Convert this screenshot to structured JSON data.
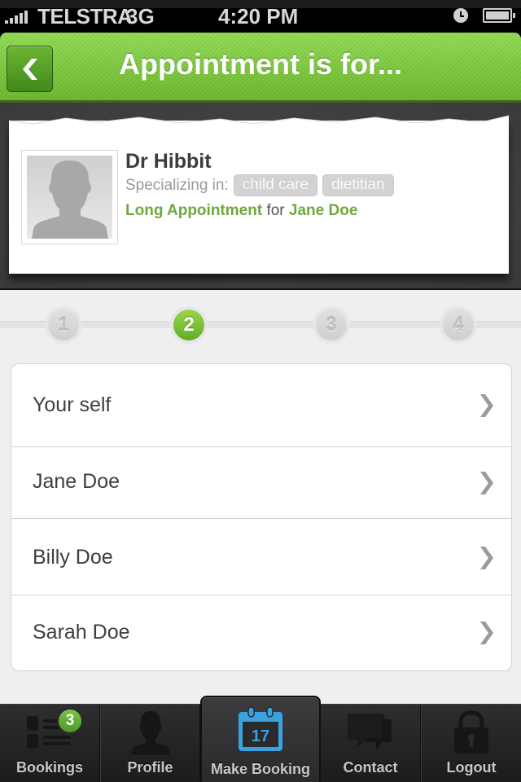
{
  "status_bar": {
    "carrier": "TELSTRA",
    "network": "3G",
    "time": "4:20 PM",
    "icons": [
      "signal-icon",
      "alarm-clock-icon",
      "battery-icon"
    ]
  },
  "nav": {
    "title": "Appointment is for...",
    "back_icon": "chevron-left-icon"
  },
  "doctor": {
    "name": "Dr Hibbit",
    "specializing_label": "Specializing in:",
    "specialties": [
      "child care",
      "dietitian"
    ],
    "appointment_type": "Long Appointment",
    "for_text": "for",
    "patient": "Jane Doe"
  },
  "stepper": {
    "steps": [
      "1",
      "2",
      "3",
      "4"
    ],
    "current_step": 2
  },
  "people": [
    {
      "label": "Your self"
    },
    {
      "label": "Jane Doe"
    },
    {
      "label": "Billy Doe"
    },
    {
      "label": "Sarah Doe"
    }
  ],
  "tab_bar": {
    "tabs": [
      {
        "label": "Bookings",
        "icon": "list-icon",
        "badge": "3"
      },
      {
        "label": "Profile",
        "icon": "person-icon"
      },
      {
        "label": "Make Booking",
        "icon": "calendar-icon",
        "calendar_day": "17",
        "active": true
      },
      {
        "label": "Contact",
        "icon": "chat-bubbles-icon"
      },
      {
        "label": "Logout",
        "icon": "padlock-icon"
      }
    ]
  },
  "colors": {
    "brand_green": "#6cb52c",
    "accent_green_text": "#6ea93e",
    "calendar_blue": "#3ba2e0",
    "tab_bar_bg": "#262626"
  }
}
